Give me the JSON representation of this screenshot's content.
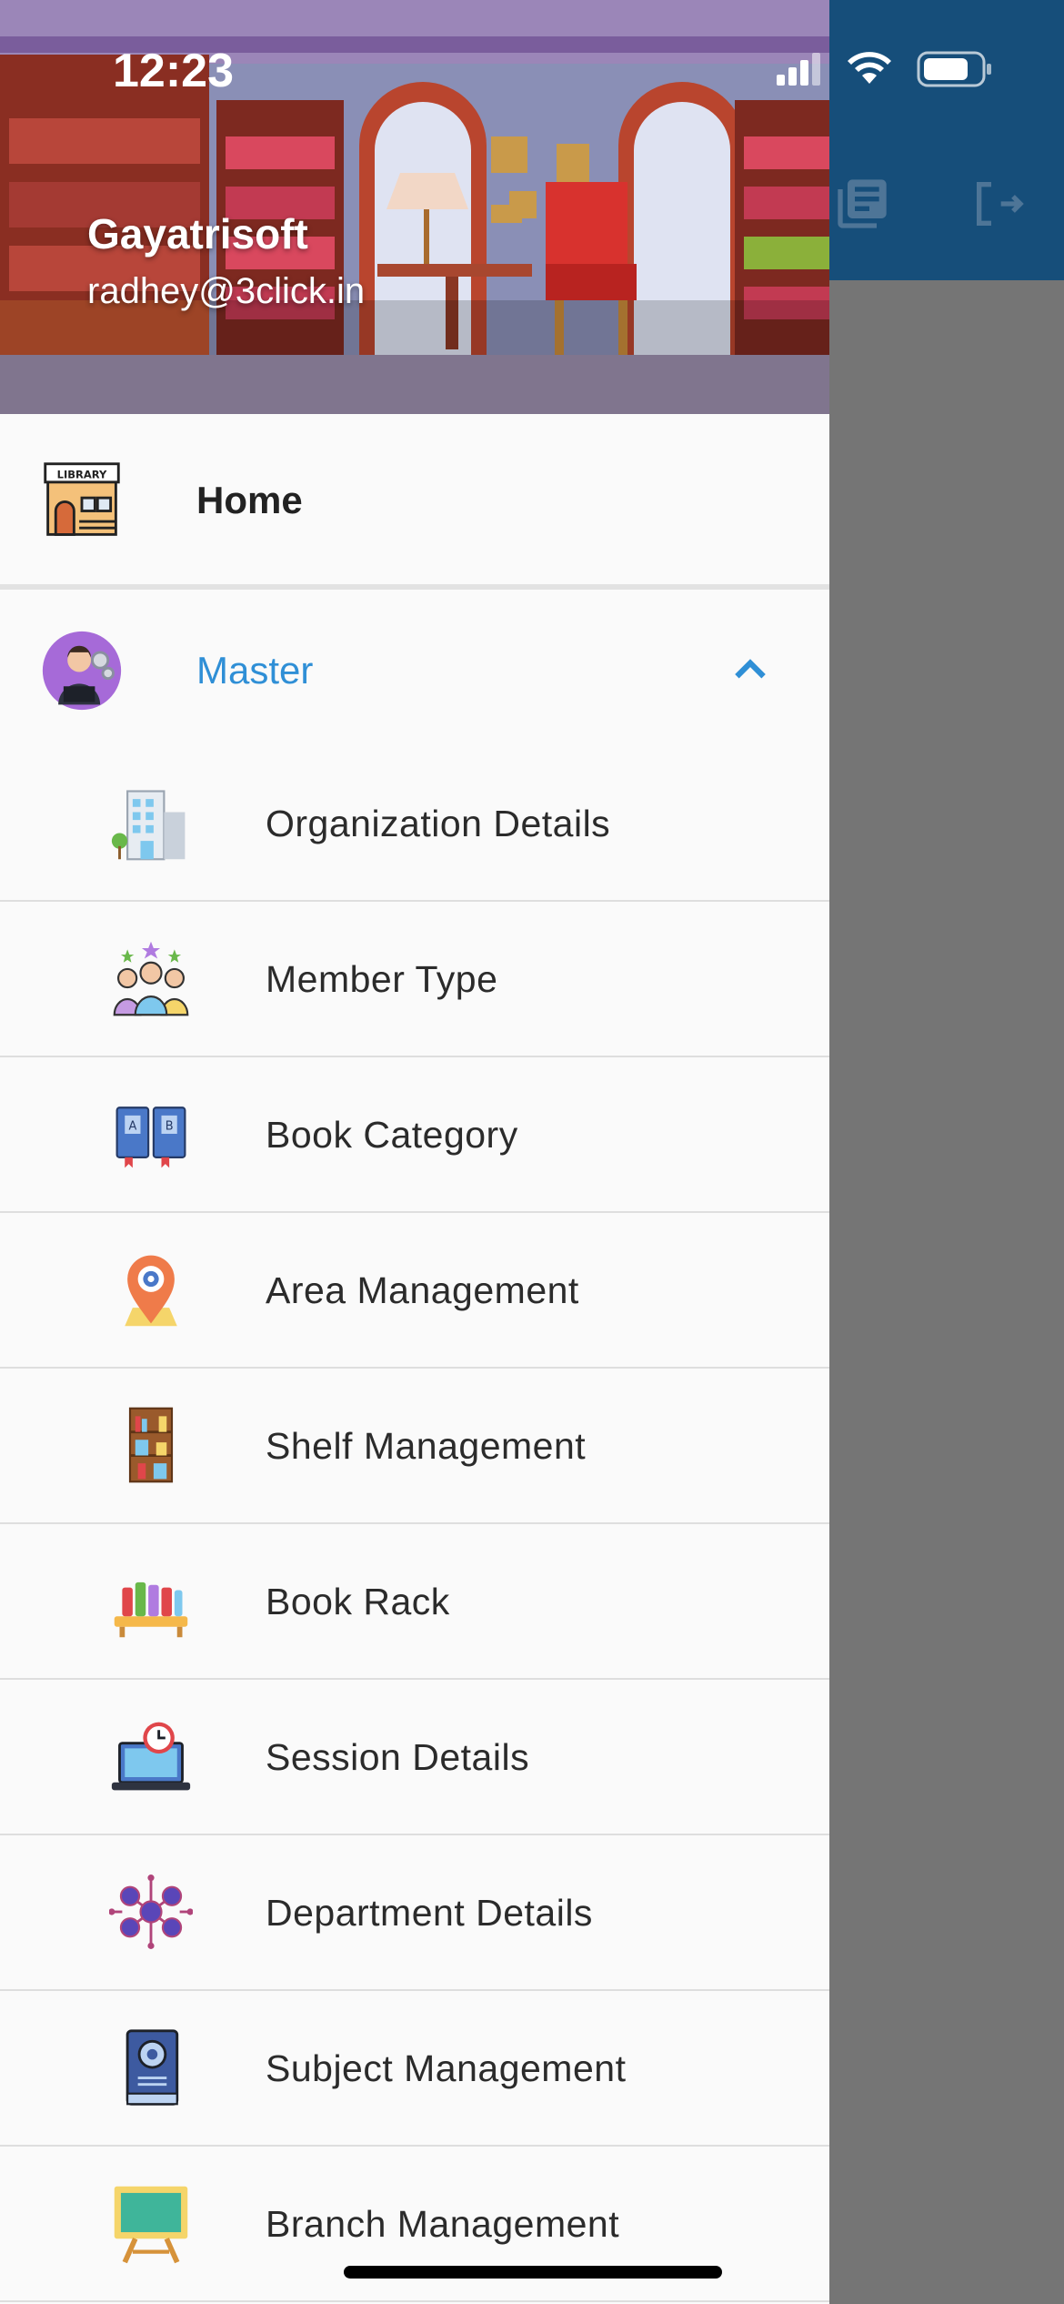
{
  "status_bar": {
    "time": "12:23"
  },
  "header": {
    "name": "Gayatrisoft",
    "email": "radhey@3click.in"
  },
  "menu": {
    "home": {
      "label": "Home",
      "icon": "library-building-icon"
    },
    "master": {
      "label": "Master",
      "icon": "admin-avatar-icon",
      "expanded": true
    },
    "items": [
      {
        "label": "Organization Details",
        "icon": "building-icon"
      },
      {
        "label": "Member Type",
        "icon": "members-group-icon"
      },
      {
        "label": "Book Category",
        "icon": "books-ab-icon"
      },
      {
        "label": "Area Management",
        "icon": "location-pin-icon"
      },
      {
        "label": "Shelf Management",
        "icon": "bookshelf-icon"
      },
      {
        "label": "Book Rack",
        "icon": "book-rack-icon"
      },
      {
        "label": "Session Details",
        "icon": "laptop-clock-icon"
      },
      {
        "label": "Department Details",
        "icon": "network-nodes-icon"
      },
      {
        "label": "Subject Management",
        "icon": "gear-book-icon"
      },
      {
        "label": "Branch Management",
        "icon": "chalkboard-icon"
      }
    ]
  },
  "appbar": {
    "actions": [
      "library-books-icon",
      "logout-icon"
    ]
  },
  "colors": {
    "accent": "#2f8fd6",
    "appbar": "#164e7a",
    "drawer_bg": "#fafafa",
    "scrim": "#757575"
  }
}
